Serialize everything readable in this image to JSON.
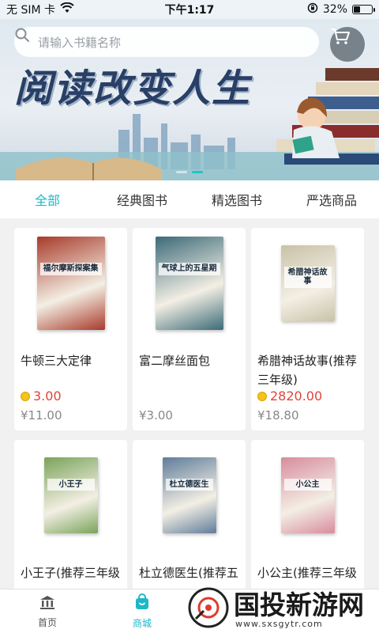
{
  "status_bar": {
    "carrier": "无 SIM 卡",
    "time": "下午1:17",
    "battery": "32%",
    "battery_level": 0.32
  },
  "banner": {
    "title": "阅读改变人生",
    "search_placeholder": "请输入书籍名称",
    "slide_count": 2,
    "active_slide": 1
  },
  "tabs": [
    {
      "label": "全部",
      "active": true
    },
    {
      "label": "经典图书",
      "active": false
    },
    {
      "label": "精选图书",
      "active": false
    },
    {
      "label": "严选商品",
      "active": false
    }
  ],
  "products": [
    {
      "name": "牛顿三大定律",
      "price": "3.00",
      "original_price": "¥11.00",
      "cover_title": "福尔摩斯探案集",
      "cover_color": "#a83a2a"
    },
    {
      "name": "富二摩丝面包",
      "price": "",
      "original_price": "¥3.00",
      "cover_title": "气球上的五星期",
      "cover_color": "#3c6a78"
    },
    {
      "name": "希腊神话故事(推荐三年级)",
      "price": "2820.00",
      "original_price": "¥18.80",
      "cover_title": "希腊神话故事",
      "cover_color": "#c9c2a8"
    },
    {
      "name": "小王子(推荐三年级",
      "price": "",
      "original_price": "",
      "cover_title": "小王子",
      "cover_color": "#7aa35a"
    },
    {
      "name": "杜立德医生(推荐五",
      "price": "",
      "original_price": "",
      "cover_title": "杜立德医生",
      "cover_color": "#5f7c9a"
    },
    {
      "name": "小公主(推荐三年级",
      "price": "",
      "original_price": "",
      "cover_title": "小公主",
      "cover_color": "#d88c9e"
    }
  ],
  "bottom_nav": [
    {
      "label": "首页",
      "icon": "bank-icon",
      "active": false
    },
    {
      "label": "商城",
      "icon": "shopping-bag-icon",
      "active": true
    }
  ],
  "watermark": {
    "text": "国投新游网",
    "url": "www.sxsgytr.com"
  },
  "colors": {
    "accent": "#1db7c8",
    "price": "#e0453a"
  }
}
